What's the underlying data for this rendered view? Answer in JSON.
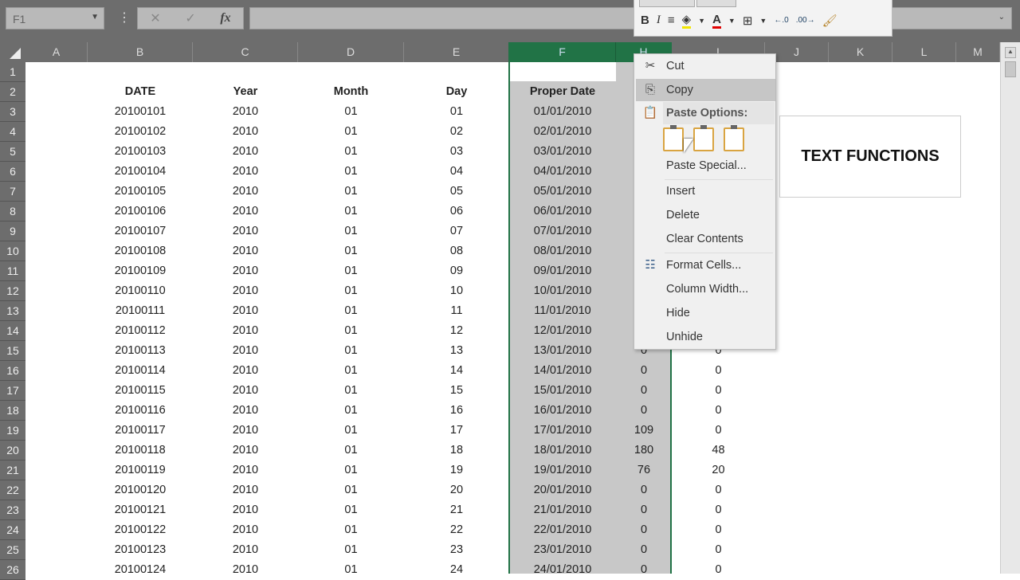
{
  "formula_bar": {
    "name_box": "F1",
    "cancel_icon": "✕",
    "enter_icon": "✓",
    "fx_label": "fx",
    "formula": ""
  },
  "columns": [
    "A",
    "B",
    "C",
    "D",
    "E",
    "F",
    "H",
    "I",
    "J",
    "K",
    "L",
    "M"
  ],
  "rows": [
    "1",
    "2",
    "3",
    "4",
    "5",
    "6",
    "7",
    "8",
    "9",
    "10",
    "11",
    "12",
    "13",
    "14",
    "15",
    "16",
    "17",
    "18",
    "19",
    "20",
    "21",
    "22",
    "23",
    "24",
    "25",
    "26"
  ],
  "headers": {
    "date": "DATE",
    "year": "Year",
    "month": "Month",
    "day": "Day",
    "proper_date": "Proper Date",
    "h_partial": "F"
  },
  "data": {
    "date": [
      "20100101",
      "20100102",
      "20100103",
      "20100104",
      "20100105",
      "20100106",
      "20100107",
      "20100108",
      "20100109",
      "20100110",
      "20100111",
      "20100112",
      "20100113",
      "20100114",
      "20100115",
      "20100116",
      "20100117",
      "20100118",
      "20100119",
      "20100120",
      "20100121",
      "20100122",
      "20100123",
      "20100124"
    ],
    "year": [
      "2010",
      "2010",
      "2010",
      "2010",
      "2010",
      "2010",
      "2010",
      "2010",
      "2010",
      "2010",
      "2010",
      "2010",
      "2010",
      "2010",
      "2010",
      "2010",
      "2010",
      "2010",
      "2010",
      "2010",
      "2010",
      "2010",
      "2010",
      "2010"
    ],
    "month": [
      "01",
      "01",
      "01",
      "01",
      "01",
      "01",
      "01",
      "01",
      "01",
      "01",
      "01",
      "01",
      "01",
      "01",
      "01",
      "01",
      "01",
      "01",
      "01",
      "01",
      "01",
      "01",
      "01",
      "01"
    ],
    "day": [
      "01",
      "02",
      "03",
      "04",
      "05",
      "06",
      "07",
      "08",
      "09",
      "10",
      "11",
      "12",
      "13",
      "14",
      "15",
      "16",
      "17",
      "18",
      "19",
      "20",
      "21",
      "22",
      "23",
      "24"
    ],
    "proper_date": [
      "01/01/2010",
      "02/01/2010",
      "03/01/2010",
      "04/01/2010",
      "05/01/2010",
      "06/01/2010",
      "07/01/2010",
      "08/01/2010",
      "09/01/2010",
      "10/01/2010",
      "11/01/2010",
      "12/01/2010",
      "13/01/2010",
      "14/01/2010",
      "15/01/2010",
      "16/01/2010",
      "17/01/2010",
      "18/01/2010",
      "19/01/2010",
      "20/01/2010",
      "21/01/2010",
      "22/01/2010",
      "23/01/2010",
      "24/01/2010"
    ],
    "h": [
      "",
      "",
      "",
      "",
      "",
      "",
      "",
      "",
      "",
      "",
      "",
      "",
      "0",
      "0",
      "0",
      "0",
      "109",
      "180",
      "76",
      "0",
      "0",
      "0",
      "0",
      "0"
    ],
    "i": [
      "",
      "",
      "",
      "",
      "",
      "",
      "",
      "",
      "",
      "",
      "",
      "",
      "0",
      "0",
      "0",
      "0",
      "0",
      "48",
      "20",
      "0",
      "0",
      "0",
      "0",
      "0"
    ]
  },
  "text_box": "TEXT FUNCTIONS",
  "mini_toolbar": {
    "bold": "B",
    "italic": "I",
    "font_color": "A"
  },
  "context_menu": {
    "cut": "Cut",
    "copy": "Copy",
    "paste_options": "Paste Options:",
    "paste_special": "Paste Special...",
    "insert": "Insert",
    "delete": "Delete",
    "clear_contents": "Clear Contents",
    "format_cells": "Format Cells...",
    "column_width": "Column Width...",
    "hide": "Hide",
    "unhide": "Unhide"
  },
  "colors": {
    "selection_header": "#217346",
    "selection_fill": "#c8c8c8",
    "chrome": "#6d6d6d"
  }
}
